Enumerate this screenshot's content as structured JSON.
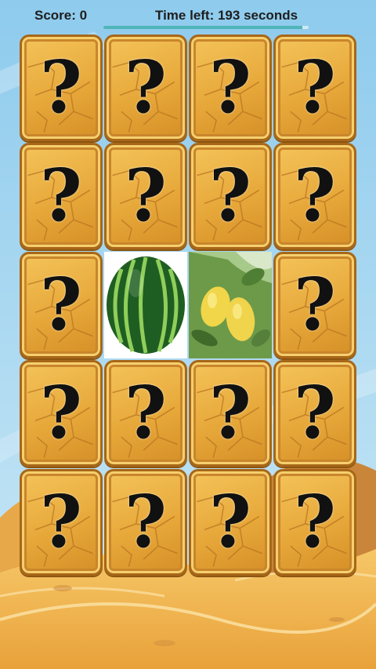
{
  "hud": {
    "score_text": "Score: 0",
    "timer_text": "Time left: 193 seconds",
    "timer_fraction": 0.97
  },
  "board": {
    "rows": 5,
    "columns": 4,
    "card_back_symbol": "?",
    "cards": [
      {
        "state": "hidden"
      },
      {
        "state": "hidden"
      },
      {
        "state": "hidden"
      },
      {
        "state": "hidden"
      },
      {
        "state": "hidden"
      },
      {
        "state": "hidden"
      },
      {
        "state": "hidden"
      },
      {
        "state": "hidden"
      },
      {
        "state": "hidden"
      },
      {
        "state": "revealed",
        "image": "watermelon-image"
      },
      {
        "state": "revealed",
        "image": "lemon-image"
      },
      {
        "state": "hidden"
      },
      {
        "state": "hidden"
      },
      {
        "state": "hidden"
      },
      {
        "state": "hidden"
      },
      {
        "state": "hidden"
      },
      {
        "state": "hidden"
      },
      {
        "state": "hidden"
      },
      {
        "state": "hidden"
      },
      {
        "state": "hidden"
      }
    ]
  },
  "colors": {
    "card_back": "#e7a83a",
    "card_border": "#a76718",
    "timer_bar": "#4eb5b8",
    "sky": "#a8d8f0",
    "sand": "#f0b44a"
  }
}
